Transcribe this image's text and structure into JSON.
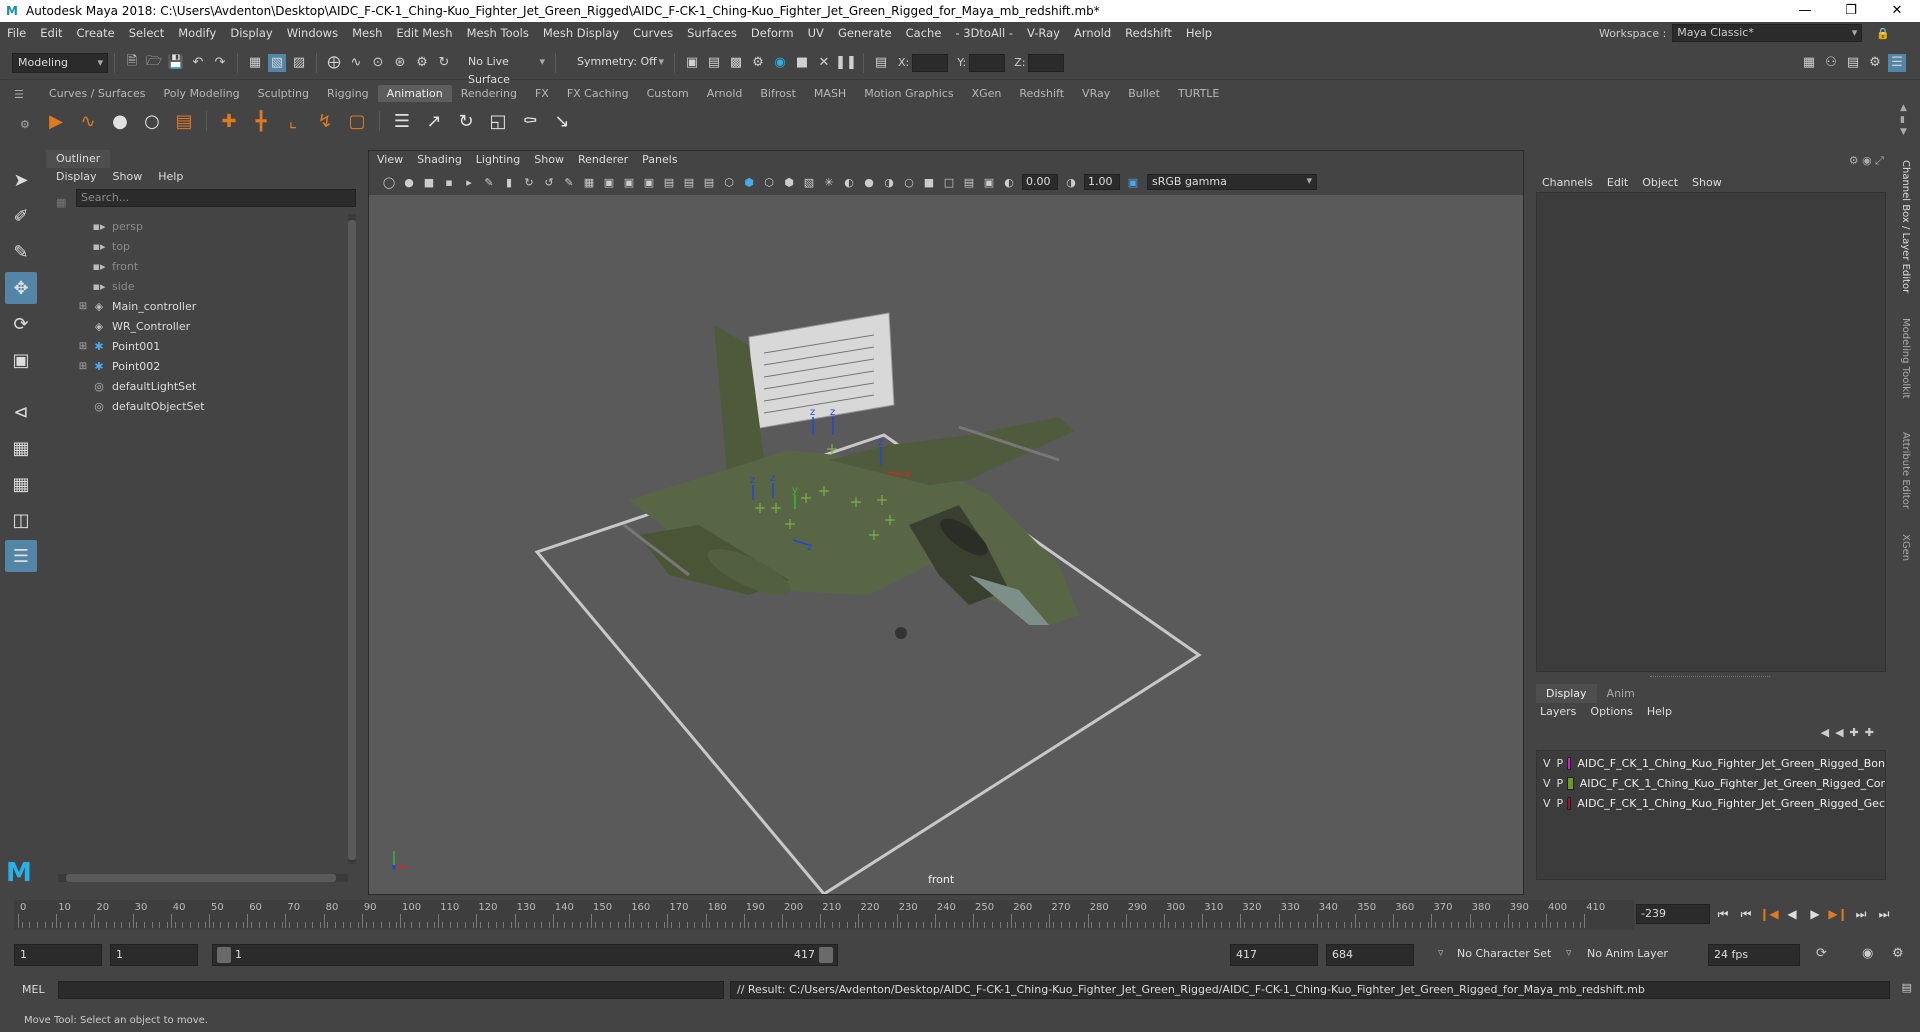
{
  "window": {
    "title": "Autodesk Maya 2018: C:\\Users\\Avdenton\\Desktop\\AIDC_F-CK-1_Ching-Kuo_Fighter_Jet_Green_Rigged\\AIDC_F-CK-1_Ching-Kuo_Fighter_Jet_Green_Rigged_for_Maya_mb_redshift.mb*",
    "app_icon": "M"
  },
  "menus": [
    "File",
    "Edit",
    "Create",
    "Select",
    "Modify",
    "Display",
    "Windows",
    "Mesh",
    "Edit Mesh",
    "Mesh Tools",
    "Mesh Display",
    "Curves",
    "Surfaces",
    "Deform",
    "UV",
    "Generate",
    "Cache",
    "- 3DtoAll -",
    "V-Ray",
    "Arnold",
    "Redshift",
    "Help"
  ],
  "workspace": {
    "label": "Workspace :",
    "value": "Maya Classic*"
  },
  "status": {
    "mode": "Modeling",
    "live_surface": "No Live Surface",
    "symmetry": "Symmetry: Off",
    "x_label": "X:",
    "y_label": "Y:",
    "z_label": "Z:"
  },
  "shelf_tabs": [
    "Curves / Surfaces",
    "Poly Modeling",
    "Sculpting",
    "Rigging",
    "Animation",
    "Rendering",
    "FX",
    "FX Caching",
    "Custom",
    "Arnold",
    "Bifrost",
    "MASH",
    "Motion Graphics",
    "XGen",
    "Redshift",
    "VRay",
    "Bullet",
    "TURTLE"
  ],
  "active_shelf_tab": "Animation",
  "outliner": {
    "tab": "Outliner",
    "menu": [
      "Display",
      "Show",
      "Help"
    ],
    "search_placeholder": "Search...",
    "items": [
      {
        "label": "persp",
        "icon": "camera-icon",
        "dim": true,
        "expandable": false
      },
      {
        "label": "top",
        "icon": "camera-icon",
        "dim": true,
        "expandable": false
      },
      {
        "label": "front",
        "icon": "camera-icon",
        "dim": true,
        "expandable": false
      },
      {
        "label": "side",
        "icon": "camera-icon",
        "dim": true,
        "expandable": false
      },
      {
        "label": "Main_controller",
        "icon": "transform-icon",
        "dim": false,
        "expandable": true
      },
      {
        "label": "WR_Controller",
        "icon": "transform-icon",
        "dim": false,
        "expandable": false
      },
      {
        "label": "Point001",
        "icon": "point-helper-icon",
        "dim": false,
        "expandable": true
      },
      {
        "label": "Point002",
        "icon": "point-helper-icon",
        "dim": false,
        "expandable": true
      },
      {
        "label": "defaultLightSet",
        "icon": "set-icon",
        "dim": false,
        "expandable": false
      },
      {
        "label": "defaultObjectSet",
        "icon": "set-icon",
        "dim": false,
        "expandable": false
      }
    ]
  },
  "viewport": {
    "menu": [
      "View",
      "Shading",
      "Lighting",
      "Show",
      "Renderer",
      "Panels"
    ],
    "exposure": "0.00",
    "gamma_value": "1.00",
    "color_space": "sRGB gamma",
    "camera_label": "front"
  },
  "channel_box": {
    "menu": [
      "Channels",
      "Edit",
      "Object",
      "Show"
    ],
    "layer_tabs": [
      "Display",
      "Anim"
    ],
    "layer_menu": [
      "Layers",
      "Options",
      "Help"
    ],
    "layers": [
      {
        "v": "V",
        "p": "P",
        "color": "#cc22cc",
        "name": "AIDC_F_CK_1_Ching_Kuo_Fighter_Jet_Green_Rigged_Bon"
      },
      {
        "v": "V",
        "p": "P",
        "color": "#6a9a2a",
        "name": "AIDC_F_CK_1_Ching_Kuo_Fighter_Jet_Green_Rigged_Cor"
      },
      {
        "v": "V",
        "p": "P",
        "color": "#a0102a",
        "name": "AIDC_F_CK_1_Ching_Kuo_Fighter_Jet_Green_Rigged_Gec"
      }
    ]
  },
  "side_tabs": [
    "Channel Box / Layer Editor",
    "Modeling Toolkit",
    "Attribute Editor",
    "XGen"
  ],
  "timeline": {
    "labels": [
      "0",
      "10",
      "20",
      "30",
      "40",
      "50",
      "60",
      "70",
      "80",
      "90",
      "100",
      "110",
      "120",
      "130",
      "140",
      "150",
      "160",
      "170",
      "180",
      "190",
      "200",
      "210",
      "220",
      "230",
      "240",
      "250",
      "260",
      "270",
      "280",
      "290",
      "300",
      "310",
      "320",
      "330",
      "340",
      "350",
      "360",
      "370",
      "380",
      "390",
      "400",
      "410"
    ],
    "current_frame": "-239"
  },
  "range": {
    "start": "1",
    "inner_start": "1",
    "slider_start": "1",
    "slider_end": "417",
    "end": "417",
    "outer_end": "684",
    "character_set": "No Character Set",
    "anim_layer": "No Anim Layer",
    "fps": "24 fps"
  },
  "command": {
    "mel_label": "MEL",
    "result": "// Result: C:/Users/Avdenton/Desktop/AIDC_F-CK-1_Ching-Kuo_Fighter_Jet_Green_Rigged/AIDC_F-CK-1_Ching-Kuo_Fighter_Jet_Green_Rigged_for_Maya_mb_redshift.mb"
  },
  "help_line": "Move Tool: Select an object to move."
}
